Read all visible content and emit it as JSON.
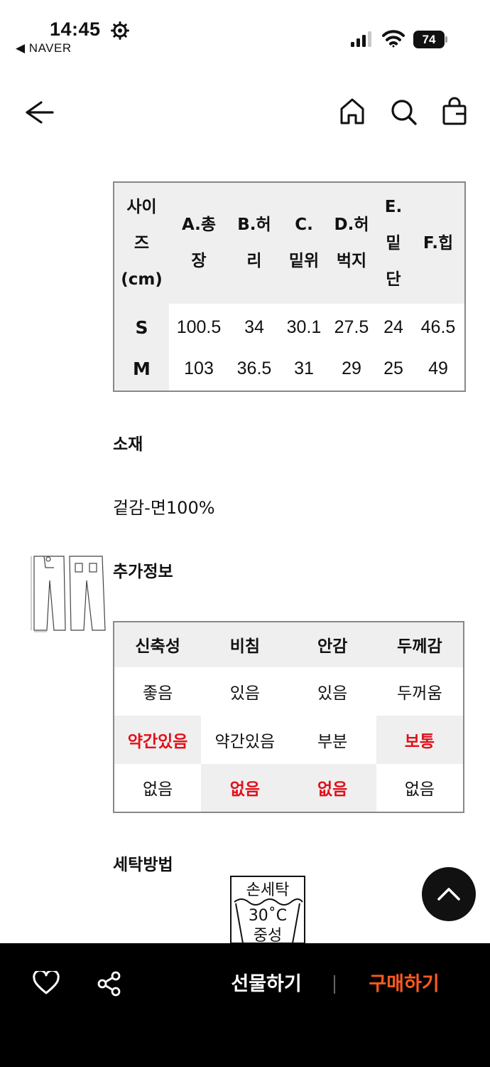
{
  "status_bar": {
    "time": "14:45",
    "back_app": "◀ NAVER",
    "battery": "74"
  },
  "size_table": {
    "headers": [
      "사이즈(cm)",
      "A.총장",
      "B.허리",
      "C.밑위",
      "D.허벅지",
      "E.밑단",
      "F.힙"
    ],
    "header_lines": [
      [
        "사이",
        "즈",
        "(cm)"
      ],
      [
        "A.총",
        "장"
      ],
      [
        "B.허",
        "리"
      ],
      [
        "C.",
        "밑위"
      ],
      [
        "D.허",
        "벅지"
      ],
      [
        "E.",
        "밑",
        "단"
      ],
      [
        "F.힙"
      ]
    ],
    "rows": [
      [
        "S",
        "100.5",
        "34",
        "30.1",
        "27.5",
        "24",
        "46.5"
      ],
      [
        "M",
        "103",
        "36.5",
        "31",
        "29",
        "25",
        "49"
      ]
    ]
  },
  "material": {
    "title": "소재",
    "value": "겉감-면100%"
  },
  "extra_info": {
    "title": "추가정보",
    "headers": [
      "신축성",
      "비침",
      "안감",
      "두께감"
    ],
    "rows": [
      [
        "좋음",
        "있음",
        "있음",
        "두꺼움"
      ],
      [
        "약간있음",
        "약간있음",
        "부분",
        "보통"
      ],
      [
        "없음",
        "없음",
        "없음",
        "없음"
      ]
    ],
    "selected": [
      [
        1,
        0
      ],
      [
        2,
        1
      ],
      [
        2,
        2
      ],
      [
        1,
        3
      ]
    ],
    "highlight_color": "#e1101a"
  },
  "washing": {
    "title": "세탁방법",
    "icon_lines": [
      "손세탁",
      "30˚C",
      "중성"
    ]
  },
  "bottom_bar": {
    "gift_label": "선물하기",
    "buy_label": "구매하기",
    "buy_color": "#ff5a1f"
  }
}
